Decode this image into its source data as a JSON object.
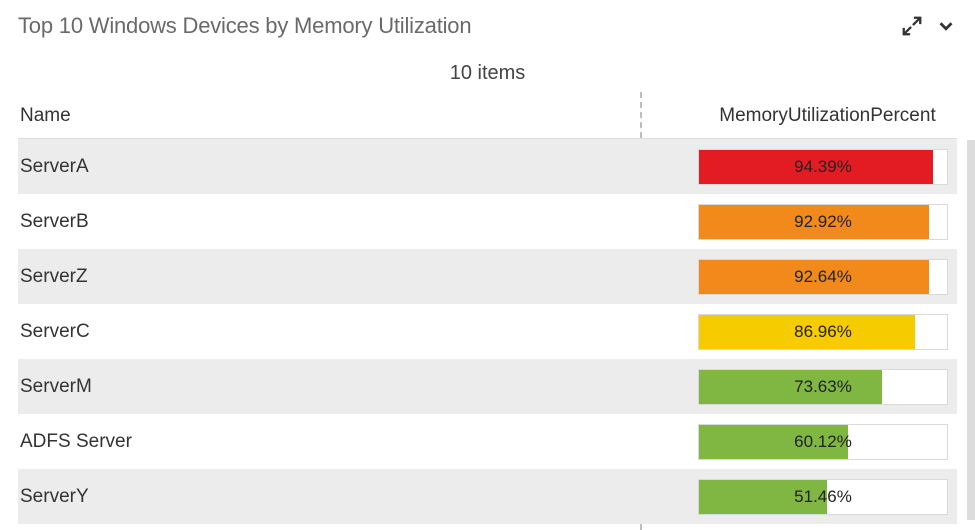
{
  "header": {
    "title": "Top 10 Windows Devices by Memory Utilization",
    "expand_icon": "expand",
    "collapse_icon": "chevron-down"
  },
  "subtitle": "10 items",
  "columns": {
    "name": "Name",
    "memory": "MemoryUtilizationPercent"
  },
  "rows": [
    {
      "name": "ServerA",
      "percent": 94.39,
      "label": "94.39%",
      "color": "#e31b23"
    },
    {
      "name": "ServerB",
      "percent": 92.92,
      "label": "92.92%",
      "color": "#f28a1b"
    },
    {
      "name": "ServerZ",
      "percent": 92.64,
      "label": "92.64%",
      "color": "#f28a1b"
    },
    {
      "name": "ServerC",
      "percent": 86.96,
      "label": "86.96%",
      "color": "#f6cc00"
    },
    {
      "name": "ServerM",
      "percent": 73.63,
      "label": "73.63%",
      "color": "#7fb742"
    },
    {
      "name": "ADFS Server",
      "percent": 60.12,
      "label": "60.12%",
      "color": "#7fb742"
    },
    {
      "name": "ServerY",
      "percent": 51.46,
      "label": "51.46%",
      "color": "#7fb742"
    }
  ],
  "chart_data": {
    "type": "bar",
    "title": "Top 10 Windows Devices by Memory Utilization",
    "xlabel": "MemoryUtilizationPercent",
    "ylabel": "Name",
    "xlim": [
      0,
      100
    ],
    "categories": [
      "ServerA",
      "ServerB",
      "ServerZ",
      "ServerC",
      "ServerM",
      "ADFS Server",
      "ServerY"
    ],
    "values": [
      94.39,
      92.92,
      92.64,
      86.96,
      73.63,
      60.12,
      51.46
    ],
    "series": [
      {
        "name": "MemoryUtilizationPercent",
        "values": [
          94.39,
          92.92,
          92.64,
          86.96,
          73.63,
          60.12,
          51.46
        ],
        "colors": [
          "#e31b23",
          "#f28a1b",
          "#f28a1b",
          "#f6cc00",
          "#7fb742",
          "#7fb742",
          "#7fb742"
        ]
      }
    ]
  }
}
